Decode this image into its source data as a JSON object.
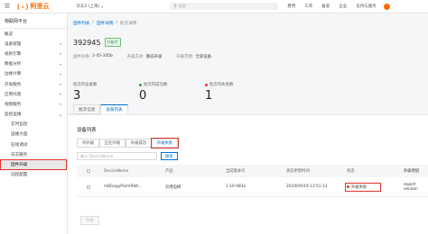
{
  "topbar": {
    "logo_mark": "(-)",
    "logo_text": "阿里云",
    "region": "华东2 (上海)",
    "search_placeholder": "搜索",
    "nav": [
      "费用",
      "工单",
      "备案",
      "企业",
      "支持与服务"
    ],
    "brand_color": "#ff6a00"
  },
  "sidebar": {
    "platform": "物联网平台",
    "items": [
      {
        "label": "概览",
        "sub": false,
        "arrow": false
      },
      {
        "label": "设备管理",
        "sub": false,
        "arrow": true
      },
      {
        "label": "规则引擎",
        "sub": false,
        "arrow": true
      },
      {
        "label": "数据分析",
        "sub": false,
        "arrow": true
      },
      {
        "label": "边缘计算",
        "sub": false,
        "arrow": true
      },
      {
        "label": "开发服务",
        "sub": false,
        "arrow": true
      },
      {
        "label": "应用托管",
        "sub": false,
        "arrow": true
      },
      {
        "label": "视频服务",
        "sub": false,
        "arrow": true
      },
      {
        "label": "监控运维",
        "sub": false,
        "arrow": true
      },
      {
        "label": "实时监控",
        "sub": true,
        "arrow": false
      },
      {
        "label": "运维大盘",
        "sub": true,
        "arrow": false
      },
      {
        "label": "在线调试",
        "sub": true,
        "arrow": false
      },
      {
        "label": "日志服务",
        "sub": true,
        "arrow": false
      },
      {
        "label": "固件升级",
        "sub": true,
        "arrow": false,
        "active": true
      },
      {
        "label": "远程配置",
        "sub": true,
        "arrow": false
      }
    ]
  },
  "breadcrumb": {
    "items": [
      "固件列表",
      "/",
      "固件详情",
      "/",
      "批次详情"
    ]
  },
  "header": {
    "title": "392945",
    "badge": "升级中",
    "meta": [
      {
        "k": "固件名称:",
        "v": "2-45-345b"
      },
      {
        "k": "升级方式:",
        "v": "静态升级"
      },
      {
        "k": "升级范围:",
        "v": "全部设备"
      }
    ]
  },
  "stats": [
    {
      "label": "批次内设备数",
      "value": "3",
      "dot": ""
    },
    {
      "label": "批次内成功数",
      "value": "0",
      "dot": "#2e9a44"
    },
    {
      "label": "批次内失败数",
      "value": "1",
      "dot": "#e0352b"
    }
  ],
  "tabs": [
    "批次信息",
    "设备列表"
  ],
  "panel": {
    "title": "设备列表",
    "subtabs": [
      "待升级",
      "正在升级",
      "升级成功",
      "升级失败"
    ],
    "filter_placeholder": "输入 DeviceName",
    "filter_button": "搜索",
    "columns": [
      "DeviceName",
      "产品",
      "当前版本号",
      "状态更新时间",
      "状态",
      "升级原因"
    ],
    "rows": [
      {
        "name": "mBGagyPszmRbK...",
        "product": "云喂电梯",
        "version": "1-10-483a",
        "time": "2019/09/19 13:51:13",
        "status": "升级失败",
        "reason": "report version"
      }
    ],
    "footer_button": "升级"
  }
}
